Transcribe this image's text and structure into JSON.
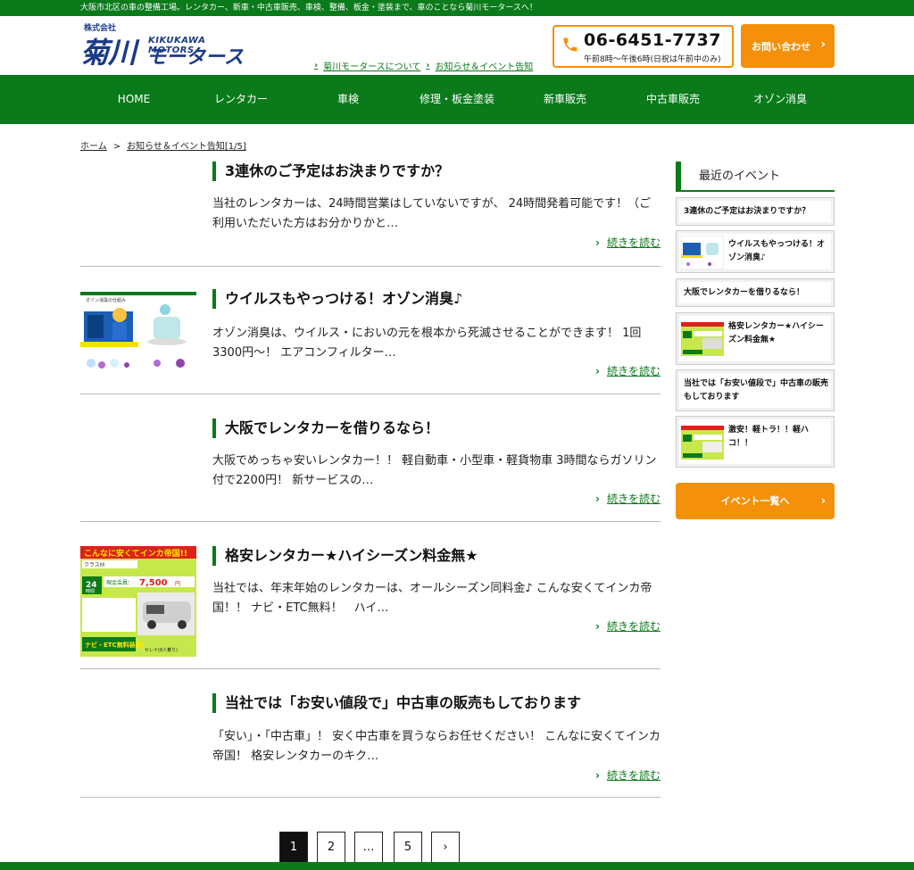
{
  "topbar": {
    "text": "大阪市北区の車の整備工場。レンタカー、新車・中古車販売、車検、整備、板金・塗装まで、車のことなら菊川モータースへ！"
  },
  "logo": {
    "kaisha": "株式会社",
    "kanji": "菊川",
    "en": "KIKUKAWA　MOTORS",
    "kana": "モータース"
  },
  "header_links": [
    {
      "label": "菊川モータースについて"
    },
    {
      "label": "お知らせ＆イベント告知"
    }
  ],
  "phone": {
    "number": "06-6451-7737",
    "hours": "午前8時〜午後6時(日祝は午前中のみ)"
  },
  "contact_button": {
    "label": "お問い合わせ",
    "arrow": "›"
  },
  "nav": [
    {
      "label": "HOME"
    },
    {
      "label": "レンタカー"
    },
    {
      "label": "車検"
    },
    {
      "label": "修理・板金塗装"
    },
    {
      "label": "新車販売"
    },
    {
      "label": "中古車販売"
    },
    {
      "label": "オゾン消臭"
    }
  ],
  "breadcrumb": {
    "home": "ホーム",
    "sep": ">",
    "current": "お知らせ＆イベント告知[1/5]"
  },
  "posts": [
    {
      "title": "3連休のご予定はお決まりですか？",
      "excerpt": "当社のレンタカーは、24時間営業はしていないですが、 24時間発着可能です！（ご利用いただいた方はお分かりかと…",
      "more": "続きを読む"
    },
    {
      "title": "ウイルスもやっつける！オゾン消臭♪",
      "excerpt": "オゾン消臭は、ウイルス・においの元を根本から死滅させることができます！ 1回3300円〜！ エアコンフィルター…",
      "more": "続きを読む"
    },
    {
      "title": "大阪でレンタカーを借りるなら！",
      "excerpt": "大阪でめっちゃ安いレンタカー！！ 軽自動車・小型車・軽貨物車 3時間ならガソリン付で2200円！ 新サービスの…",
      "more": "続きを読む"
    },
    {
      "title": "格安レンタカー★ハイシーズン料金無★",
      "excerpt": "当社では、年末年始のレンタカーは、オールシーズン同料金♪ こんな安くてインカ帝国！！ ナビ・ETC無料！　ハイ…",
      "more": "続きを読む"
    },
    {
      "title": "当社では「お安い値段で」中古車の販売もしております",
      "excerpt": "「安い」・「中古車」！ 安く中古車を買うならお任せください！ こんなに安くてインカ帝国！ 格安レンタカーのキク…",
      "more": "続きを読む"
    }
  ],
  "thumb_rental": {
    "headline": "こんなに安くてインカ帝国!!",
    "class": "クラスM",
    "hours": "24",
    "hours_unit": "時間",
    "member": "現金会員：",
    "price": "7,500",
    "price_unit": "円",
    "car": "セレナ(8人乗り)",
    "footer": "ナビ・ETC無料装備！"
  },
  "thumb_ozone": {
    "caption": "オゾン消臭の仕組み"
  },
  "sidebar": {
    "heading": "最近のイベント",
    "items": [
      {
        "label": "3連休のご予定はお決まりですか？"
      },
      {
        "label": "ウイルスもやっつける！オゾン消臭♪"
      },
      {
        "label": "大阪でレンタカーを借りるなら！"
      },
      {
        "label": "格安レンタカー★ハイシーズン料金無★"
      },
      {
        "label": "当社では「お安い値段で」中古車の販売もしております"
      },
      {
        "label": "激安！軽トラ！！軽ハコ！！"
      }
    ],
    "button": "イベント一覧へ",
    "button_arrow": "›"
  },
  "pagination": [
    {
      "label": "1"
    },
    {
      "label": "2"
    },
    {
      "label": "…"
    },
    {
      "label": "5"
    },
    {
      "label": "›"
    }
  ],
  "colors": {
    "brand_green": "#0a7a1a",
    "accent_orange": "#f5900a",
    "logo_blue": "#1a3a8a"
  }
}
